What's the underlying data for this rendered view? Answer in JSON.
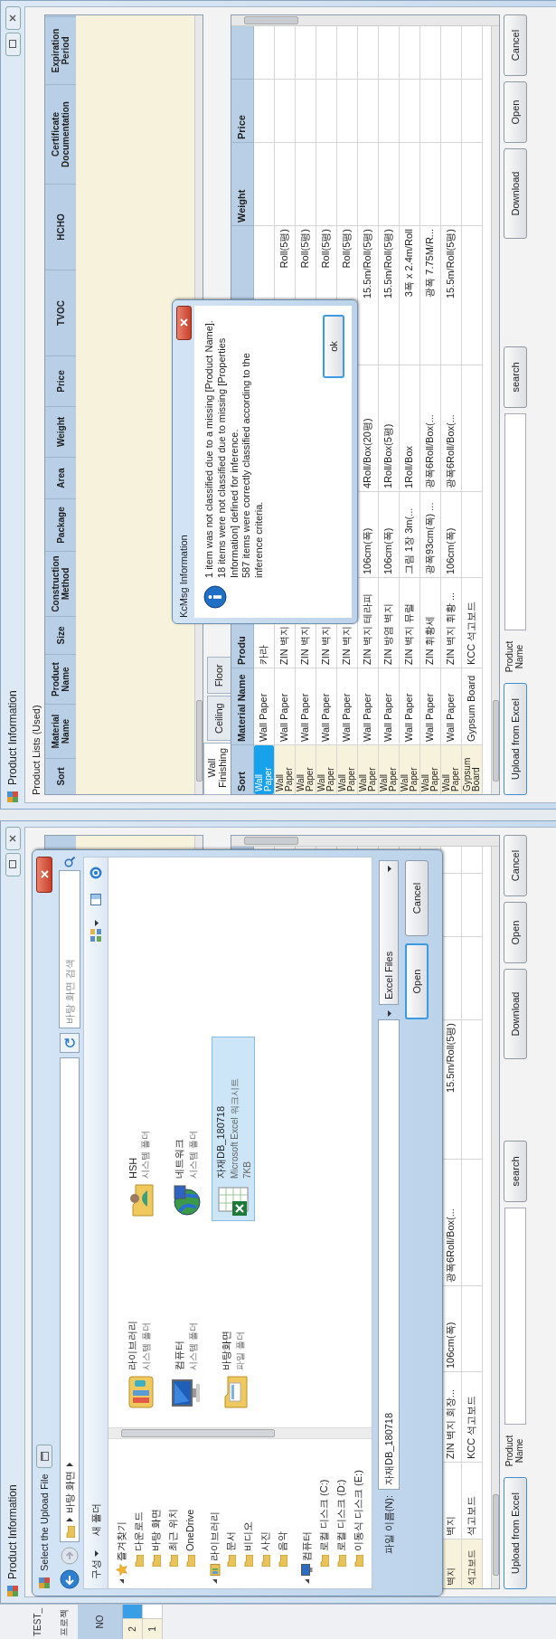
{
  "screens": [
    {
      "kind": "file_upload",
      "background_window": {
        "title": "TEST_",
        "label": "프로젝",
        "table_header": "NO",
        "rows": [
          {
            "no": "2",
            "selected": true
          },
          {
            "no": "1",
            "selected": false
          }
        ]
      },
      "window": {
        "title": "Product Information",
        "lower_table": {
          "rows": [
            {
              "selected": false,
              "sort": "벽지",
              "material_name": "벽지",
              "product_name": "ZIN 벽지 회장...",
              "column_4": "106cm(폭)",
              "column_5": "광폭6Roll/Box(...",
              "column_6": "15.5m/Roll(5평)"
            },
            {
              "selected": false,
              "sort": "석고보드",
              "material_name": "석고보드",
              "product_name": "KCC 석고보드"
            }
          ]
        },
        "bottom_bar": {
          "upload_button": "Upload from Excel",
          "search_label": "Product Name",
          "search_button": "search",
          "buttons": [
            "Download",
            "Open",
            "Cancel"
          ]
        }
      },
      "file_dialog": {
        "title": "Select the Upload File",
        "address": "바탕 화면",
        "search_placeholder": "바탕 화면 검색",
        "organize": "구성",
        "new_folder": "새 폴더",
        "nav": [
          {
            "label": "즐겨찾기",
            "kind": "favorites",
            "children": [
              {
                "label": "다운로드"
              },
              {
                "label": "바탕 화면"
              },
              {
                "label": "최근 위치"
              },
              {
                "label": "OneDrive"
              }
            ]
          },
          {
            "label": "라이브러리",
            "kind": "library",
            "children": [
              {
                "label": "문서"
              },
              {
                "label": "비디오"
              },
              {
                "label": "사진"
              },
              {
                "label": "음악"
              }
            ]
          },
          {
            "label": "컴퓨터",
            "kind": "computer",
            "children": [
              {
                "label": "로컬 디스크 (C:)"
              },
              {
                "label": "로컬 디스크 (D:)"
              },
              {
                "label": "이동식 디스크 (E:)"
              }
            ]
          }
        ],
        "items": [
          {
            "kind": "library",
            "name": "라이브러리",
            "type_label": "시스템 폴더",
            "selected": false
          },
          {
            "kind": "computer",
            "name": "컴퓨터",
            "type_label": "시스템 폴더",
            "selected": false
          },
          {
            "kind": "folder",
            "name": "바탕화면",
            "type_label": "파일 폴더",
            "selected": false
          },
          {
            "kind": "user",
            "name": "HSH",
            "type_label": "시스템 폴더",
            "selected": false
          },
          {
            "kind": "network",
            "name": "네트워크",
            "type_label": "시스템 폴더",
            "selected": false
          },
          {
            "kind": "excel",
            "name": "자재DB_180718",
            "type_label": "Microsoft Excel 워크시트",
            "size": "7KB",
            "selected": true
          }
        ],
        "file_name_label": "파일 이름(N):",
        "file_name": "자재DB_180718",
        "file_type": "Excel Files",
        "buttons": [
          {
            "label": "Open",
            "default": true
          },
          {
            "label": "Cancel",
            "default": false
          }
        ]
      }
    },
    {
      "kind": "classification_result",
      "window": {
        "title": "Product Information",
        "list_title": "Product Lists (Used)",
        "upper_table": {
          "columns": [
            "Sort",
            "Material Name",
            "Product Name",
            "Size",
            "Construction Method",
            "Package",
            "Area",
            "Weight",
            "Price",
            "TVOC",
            "HCHO",
            "Certificate Documentation",
            "Expiration Period"
          ]
        },
        "tabs": [
          {
            "label": "Wall Finishing",
            "selected": true
          },
          {
            "label": "Ceiling",
            "selected": false
          },
          {
            "label": "Floor",
            "selected": false
          }
        ],
        "lower_table": {
          "headers": {
            "sort": "Sort",
            "material_name": "Material Name",
            "product_name": "Produ",
            "weight": "Weight",
            "price": "Price"
          },
          "rows": [
            {
              "selected": true,
              "sort": "Wall Paper",
              "material_name": "Wall Paper",
              "product_name": "카라"
            },
            {
              "selected": false,
              "sort": "Wall Paper",
              "material_name": "Wall Paper",
              "product_name": "ZIN 벽지",
              "column_6": "Roll(5평)"
            },
            {
              "selected": false,
              "sort": "Wall Paper",
              "material_name": "Wall Paper",
              "product_name": "ZIN 벽지",
              "column_6": "Roll(5평)"
            },
            {
              "selected": false,
              "sort": "Wall Paper",
              "material_name": "Wall Paper",
              "product_name": "ZIN 벽지",
              "column_6": "Roll(5평)"
            },
            {
              "selected": false,
              "sort": "Wall Paper",
              "material_name": "Wall Paper",
              "product_name": "ZIN 벽지",
              "column_6": "Roll(5평)"
            },
            {
              "selected": false,
              "sort": "Wall Paper",
              "material_name": "Wall Paper",
              "product_name": "ZIN 벽지 테라피",
              "column_4": "106cm(폭)",
              "column_5": "4Roll/Box(20평)",
              "column_6": "15.5m/Roll(5평)"
            },
            {
              "selected": false,
              "sort": "Wall Paper",
              "material_name": "Wall Paper",
              "product_name": "ZIN 방염 벽지",
              "column_4": "106cm(폭)",
              "column_5": "1Roll/Box(5평)",
              "column_6": "15.5m/Roll(5평)"
            },
            {
              "selected": false,
              "sort": "Wall Paper",
              "material_name": "Wall Paper",
              "product_name": "ZIN 벽지 뮤럴",
              "column_4": "그림 1장 3m(...",
              "column_5": "1Roll/Box",
              "column_6": "3폭 x 2.4m/Roll"
            },
            {
              "selected": false,
              "sort": "Wall Paper",
              "material_name": "Wall Paper",
              "product_name": "ZIN 휘황세",
              "column_4": "광폭93cm(폭) ...",
              "column_5": "광폭6Roll/Box(...",
              "column_6": "광폭 7.75M/R..."
            },
            {
              "selected": false,
              "sort": "Wall Paper",
              "material_name": "Wall Paper",
              "product_name": "ZIN 벽지 휘황 ...",
              "column_4": "106cm(폭)",
              "column_5": "광폭6Roll/Box(...",
              "column_6": "15.5m/Roll(5평)"
            },
            {
              "selected": false,
              "sort": "Gypsum Board",
              "material_name": "Gypsum Board",
              "product_name": "KCC 석고보드"
            }
          ]
        },
        "bottom_bar": {
          "upload_button": "Upload from Excel",
          "search_label": "Product Name",
          "search_button": "search",
          "buttons": [
            "Download",
            "Open",
            "Cancel"
          ]
        }
      },
      "message_dialog": {
        "title": "KcMsg Information",
        "messages": [
          "1 item was not classified due to a missing [Product Name].",
          "18 items were not classified due to missing [Properties Information] defined for inference.",
          "587 items were correctly classified according to the inference criteria."
        ],
        "button": "ok"
      }
    }
  ]
}
